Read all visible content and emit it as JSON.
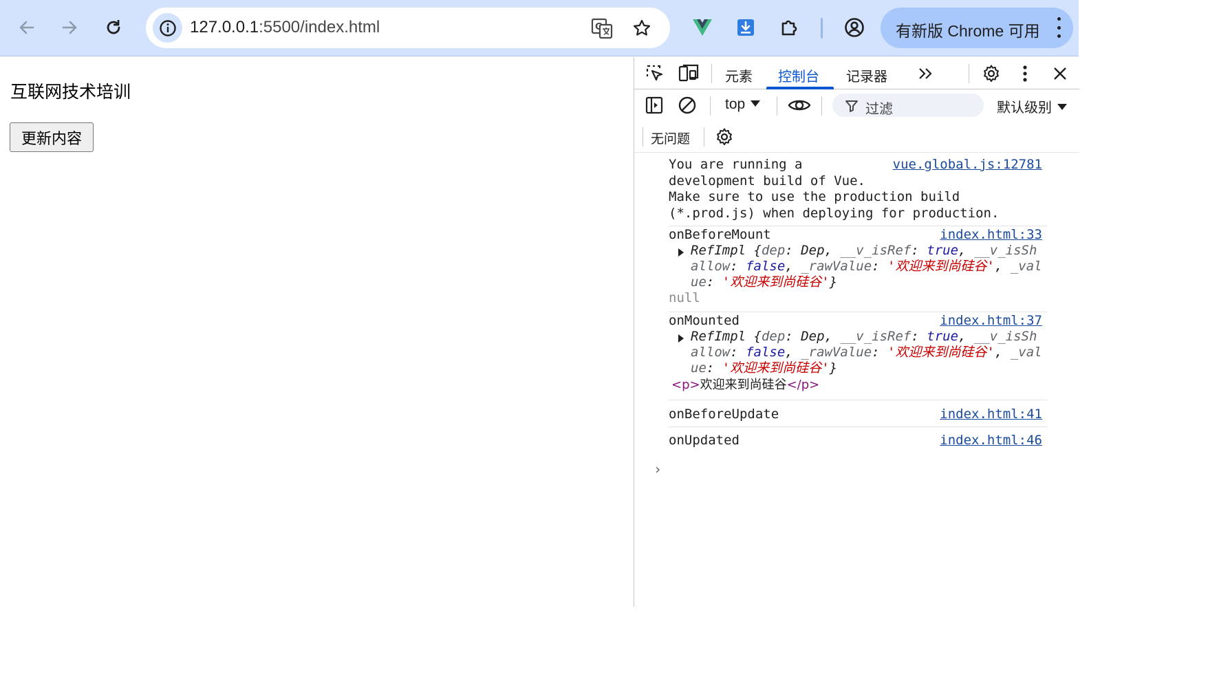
{
  "browser": {
    "url_host": "127.0.0.1",
    "url_path": ":5500/index.html",
    "update_label": "有新版 Chrome 可用"
  },
  "page": {
    "title": "互联网技术培训",
    "update_button": "更新内容"
  },
  "devtools": {
    "tabs": [
      {
        "label": "元素",
        "active": false
      },
      {
        "label": "控制台",
        "active": true
      },
      {
        "label": "记录器",
        "active": false
      }
    ],
    "more_tabs_label": "»",
    "context": "top",
    "filter_placeholder": "过滤",
    "level": "默认级别",
    "issues": "无问题",
    "accent_color": "#0b57d0",
    "console": [
      {
        "lines": [
          "You are running a",
          "development build of Vue.",
          "Make sure to use the production build",
          "(*.prod.js) when deploying for production."
        ],
        "source": "vue.global.js:12781"
      },
      {
        "label": "onBeforeMount",
        "source": "index.html:33",
        "object": {
          "line1_class": "RefImpl",
          "dep_key": "dep",
          "dep_val": "Dep",
          "isref_key": "__v_isRef",
          "isref_val": "true",
          "isshallow_key_start": "__v_isSh",
          "isshallow_key_end": "allow",
          "isshallow_val": "false",
          "rawvalue_key": "_rawValue",
          "rawvalue_val": "'欢迎来到尚硅谷'",
          "val_key_start": "_val",
          "val_key_end": "ue",
          "val_val": "'欢迎来到尚硅谷'"
        },
        "extra": "null"
      },
      {
        "label": "onMounted",
        "source": "index.html:37",
        "object": {
          "line1_class": "RefImpl",
          "dep_key": "dep",
          "dep_val": "Dep",
          "isref_key": "__v_isRef",
          "isref_val": "true",
          "isshallow_key_start": "__v_isSh",
          "isshallow_key_end": "allow",
          "isshallow_val": "false",
          "rawvalue_key": "_rawValue",
          "rawvalue_val": "'欢迎来到尚硅谷'",
          "val_key_start": "_val",
          "val_key_end": "ue",
          "val_val": "'欢迎来到尚硅谷'"
        },
        "element": {
          "open_tag": "<p>",
          "text": "欢迎来到尚硅谷",
          "close_tag": "</p>"
        }
      },
      {
        "label": "onBeforeUpdate",
        "source": "index.html:41"
      },
      {
        "label": "onUpdated",
        "source": "index.html:46"
      }
    ],
    "prompt": "›"
  }
}
